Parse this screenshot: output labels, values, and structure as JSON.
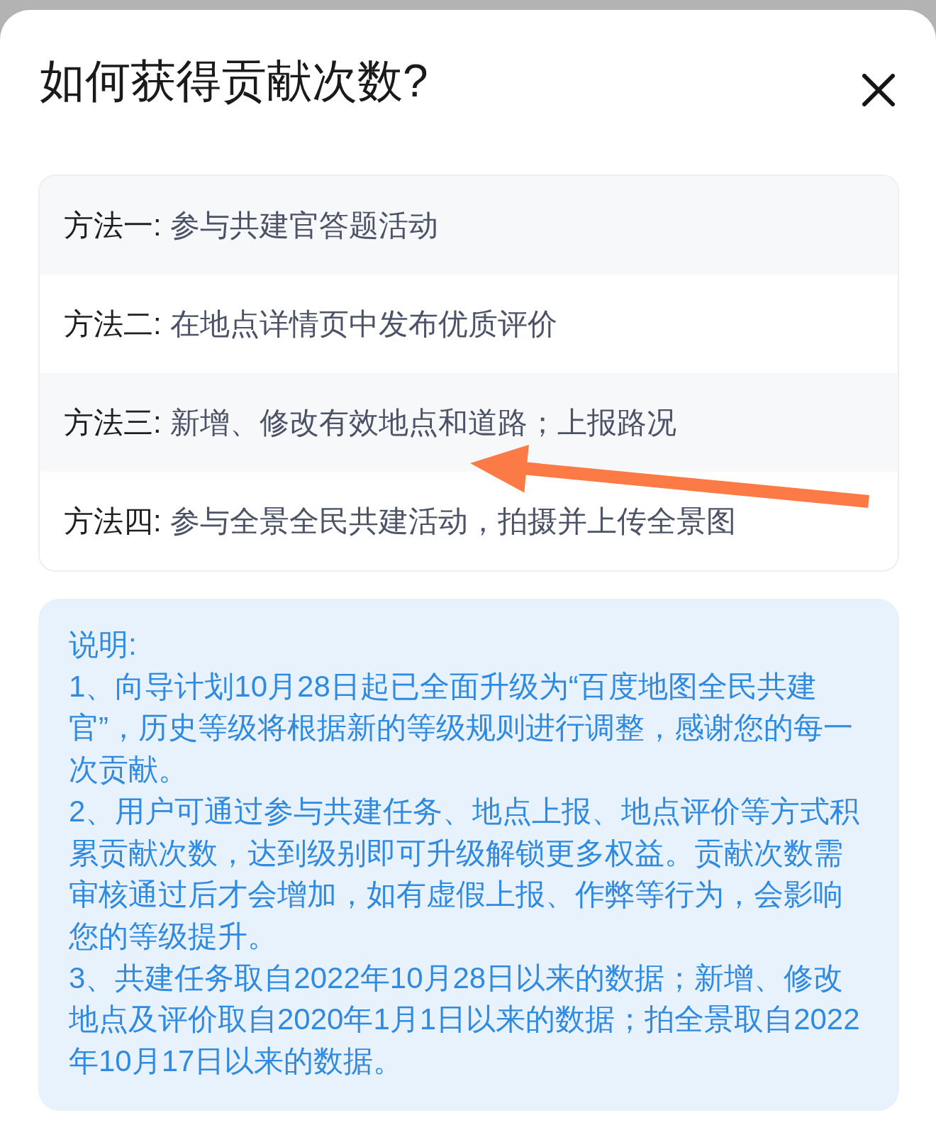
{
  "sheet": {
    "title": "如何获得贡献次数?"
  },
  "methods": [
    {
      "label": "方法一:",
      "text": "参与共建官答题活动"
    },
    {
      "label": "方法二:",
      "text": "在地点详情页中发布优质评价"
    },
    {
      "label": "方法三:",
      "text": "新增、修改有效地点和道路；上报路况"
    },
    {
      "label": "方法四:",
      "text": "参与全景全民共建活动，拍摄并上传全景图"
    }
  ],
  "note": {
    "heading": "说明:",
    "items": [
      "1、向导计划10月28日起已全面升级为“百度地图全民共建官”，历史等级将根据新的等级规则进行调整，感谢您的每一次贡献。",
      "2、用户可通过参与共建任务、地点上报、地点评价等方式积累贡献次数，达到级别即可升级解锁更多权益。贡献次数需审核通过后才会增加，如有虚假上报、作弊等行为，会影响您的等级提升。",
      "3、共建任务取自2022年10月28日以来的数据；新增、修改地点及评价取自2020年1月1日以来的数据；拍全景取自2022年10月17日以来的数据。"
    ]
  }
}
